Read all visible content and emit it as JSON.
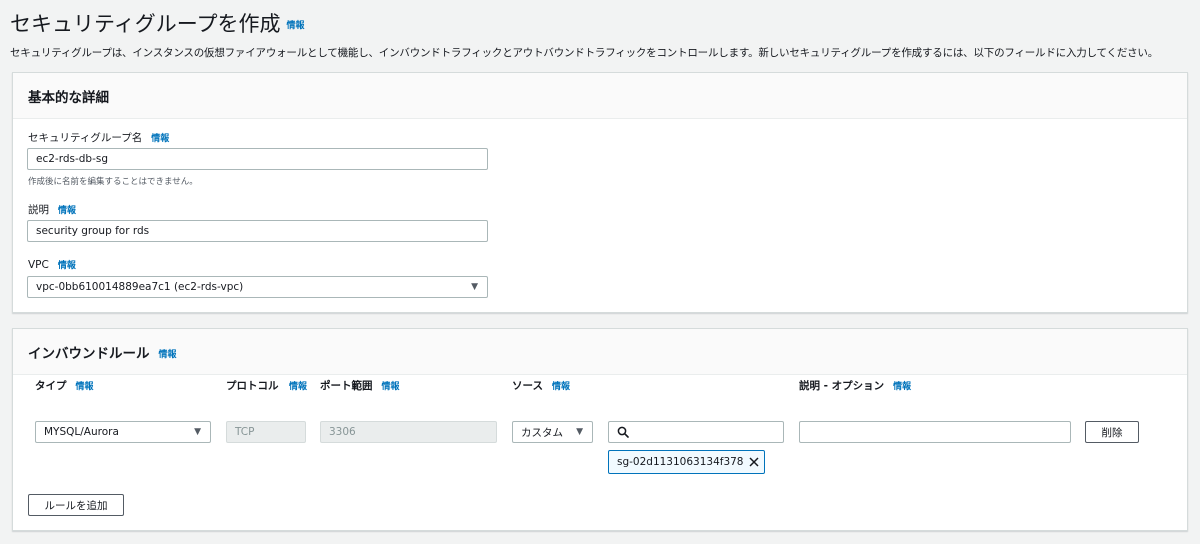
{
  "page": {
    "title": "セキュリティグループを作成",
    "title_info": "情報",
    "description": "セキュリティグループは、インスタンスの仮想ファイアウォールとして機能し、インバウンドトラフィックとアウトバウンドトラフィックをコントロールします。新しいセキュリティグループを作成するには、以下のフィールドに入力してください。"
  },
  "basic": {
    "title": "基本的な詳細",
    "name_label": "セキュリティグループ名",
    "name_info": "情報",
    "name_value": "ec2-rds-db-sg",
    "name_hint": "作成後に名前を編集することはできません。",
    "desc_label": "説明",
    "desc_info": "情報",
    "desc_value": "security group for rds",
    "vpc_label": "VPC",
    "vpc_info": "情報",
    "vpc_value": "vpc-0bb610014889ea7c1 (ec2-rds-vpc)"
  },
  "inbound": {
    "title": "インバウンドルール",
    "title_info": "情報",
    "columns": {
      "type": "タイプ",
      "type_info": "情報",
      "protocol": "プロトコル",
      "protocol_info": "情報",
      "port": "ポート範囲",
      "port_info": "情報",
      "source": "ソース",
      "source_info": "情報",
      "description": "説明 - オプション",
      "description_info": "情報"
    },
    "rule": {
      "type": "MYSQL/Aurora",
      "protocol": "TCP",
      "port": "3306",
      "source_type": "カスタム",
      "source_search": "",
      "source_token": "sg-02d1131063134f378",
      "description": "",
      "delete_label": "削除"
    },
    "add_rule_label": "ルールを追加"
  }
}
